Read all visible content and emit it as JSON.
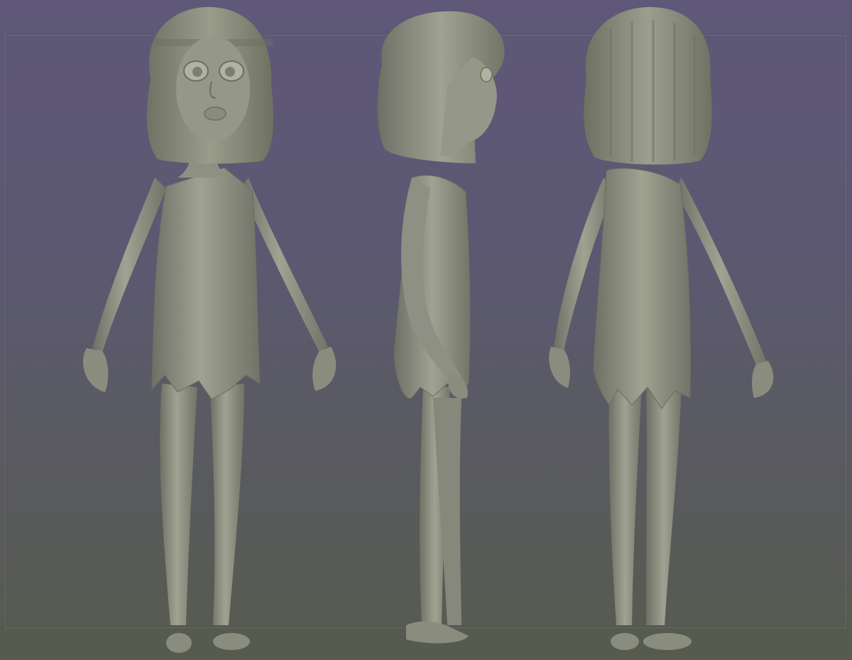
{
  "scene": {
    "background_top": "#5f5878",
    "background_bottom": "#565b4e",
    "frame_color": "#96708c",
    "clay_color": "#8c8f80",
    "clay_shadow": "#6d7064",
    "clay_highlight": "#a6a898",
    "hair_color": "#8a8c7e"
  },
  "views": [
    {
      "id": "front"
    },
    {
      "id": "side"
    },
    {
      "id": "back"
    }
  ]
}
